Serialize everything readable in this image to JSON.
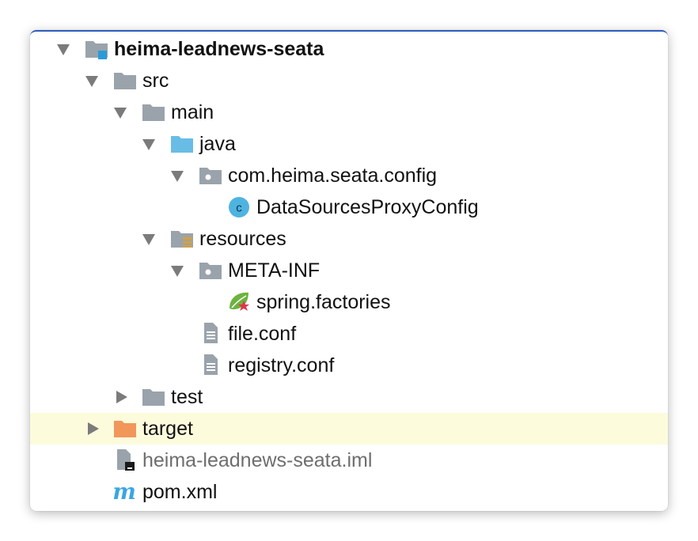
{
  "tree": {
    "root": {
      "label": "heima-leadnews-seata",
      "icon": "module-folder-icon"
    },
    "src": {
      "label": "src"
    },
    "main": {
      "label": "main"
    },
    "java": {
      "label": "java"
    },
    "package": {
      "label": "com.heima.seata.config"
    },
    "class": {
      "label": "DataSourcesProxyConfig"
    },
    "resources": {
      "label": "resources"
    },
    "metainf": {
      "label": "META-INF"
    },
    "spring": {
      "label": "spring.factories"
    },
    "fileconf": {
      "label": "file.conf"
    },
    "registry": {
      "label": "registry.conf"
    },
    "test": {
      "label": "test"
    },
    "target": {
      "label": "target"
    },
    "iml": {
      "label": "heima-leadnews-seata.iml"
    },
    "pom": {
      "label": "pom.xml"
    }
  },
  "colors": {
    "folder_gray": "#9aa3ab",
    "folder_blue": "#68bde6",
    "folder_orange": "#f2975a",
    "class_circle": "#4fb3e0",
    "selected_row": "#fcfbdc",
    "maven_blue": "#3ba5e3"
  }
}
